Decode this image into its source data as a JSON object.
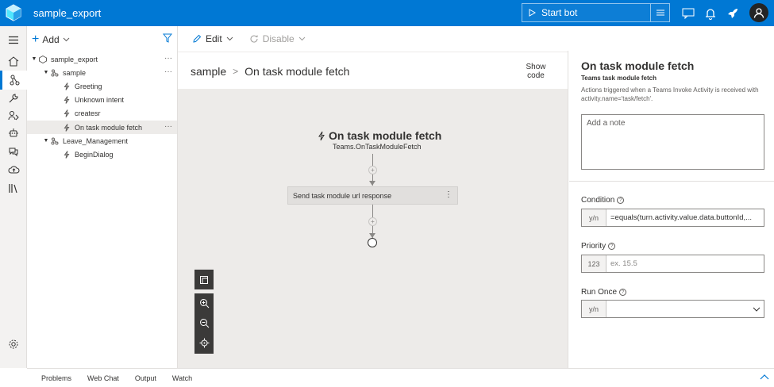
{
  "app": {
    "title": "sample_export"
  },
  "header": {
    "start_bot_label": "Start bot"
  },
  "tree_panel": {
    "add_label": "Add",
    "items": [
      {
        "label": "sample_export",
        "level": 0,
        "expandable": true,
        "type": "bot",
        "more": true
      },
      {
        "label": "sample",
        "level": 1,
        "expandable": true,
        "type": "dialog",
        "more": true
      },
      {
        "label": "Greeting",
        "level": 2,
        "expandable": false,
        "type": "trigger",
        "more": false
      },
      {
        "label": "Unknown intent",
        "level": 2,
        "expandable": false,
        "type": "trigger",
        "more": false
      },
      {
        "label": "createsr",
        "level": 2,
        "expandable": false,
        "type": "trigger",
        "more": false
      },
      {
        "label": "On task module fetch",
        "level": 2,
        "expandable": false,
        "type": "trigger",
        "more": true,
        "selected": true
      },
      {
        "label": "Leave_Management",
        "level": 1,
        "expandable": true,
        "type": "dialog",
        "more": false
      },
      {
        "label": "BeginDialog",
        "level": 2,
        "expandable": false,
        "type": "trigger",
        "more": false
      }
    ]
  },
  "center": {
    "edit_label": "Edit",
    "disable_label": "Disable",
    "breadcrumb": [
      "sample",
      "On task module fetch"
    ],
    "show_code_line1": "Show",
    "show_code_line2": "code",
    "trigger_title": "On task module fetch",
    "trigger_subtitle": "Teams.OnTaskModuleFetch",
    "action_label": "Send task module url response"
  },
  "properties": {
    "title": "On task module fetch",
    "subtitle": "Teams task module fetch",
    "description": "Actions triggered when a Teams Invoke Activity is received with activity.name='task/fetch'.",
    "note_placeholder": "Add a note",
    "condition_label": "Condition",
    "condition_prefix": "y/n",
    "condition_value": "=equals(turn.activity.value.data.buttonId,...",
    "priority_label": "Priority",
    "priority_prefix": "123",
    "priority_placeholder": "ex. 15.5",
    "run_once_label": "Run Once",
    "run_once_prefix": "y/n",
    "run_once_value": ""
  },
  "bottom_tabs": [
    "Problems",
    "Web Chat",
    "Output",
    "Watch"
  ],
  "colors": {
    "brand": "#0078d4",
    "canvas": "#edebe9"
  }
}
